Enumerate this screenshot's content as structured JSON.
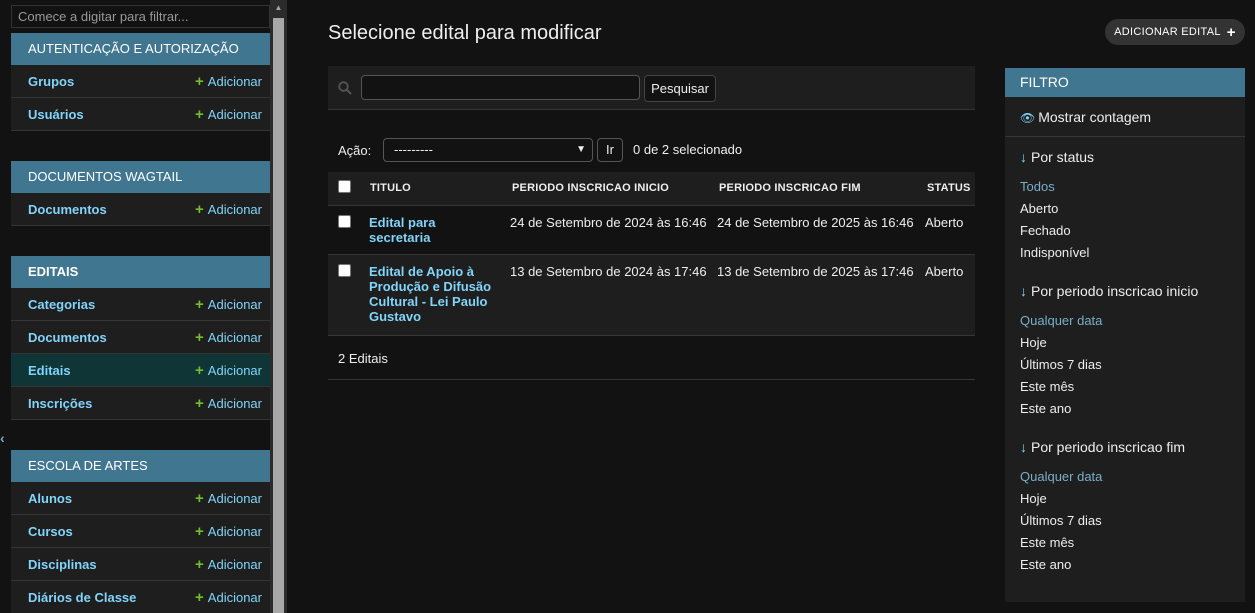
{
  "nav": {
    "filter_placeholder": "Comece a digitar para filtrar...",
    "modules": [
      {
        "caption": "AUTENTICAÇÃO E AUTORIZAÇÃO",
        "items": [
          {
            "label": "Grupos",
            "add": "Adicionar"
          },
          {
            "label": "Usuários",
            "add": "Adicionar"
          }
        ]
      },
      {
        "caption": "DOCUMENTOS WAGTAIL",
        "items": [
          {
            "label": "Documentos",
            "add": "Adicionar"
          }
        ]
      },
      {
        "caption": "EDITAIS",
        "items": [
          {
            "label": "Categorias",
            "add": "Adicionar"
          },
          {
            "label": "Documentos",
            "add": "Adicionar"
          },
          {
            "label": "Editais",
            "add": "Adicionar"
          },
          {
            "label": "Inscrições",
            "add": "Adicionar"
          }
        ]
      },
      {
        "caption": "ESCOLA DE ARTES",
        "items": [
          {
            "label": "Alunos",
            "add": "Adicionar"
          },
          {
            "label": "Cursos",
            "add": "Adicionar"
          },
          {
            "label": "Disciplinas",
            "add": "Adicionar"
          },
          {
            "label": "Diários de Classe",
            "add": "Adicionar"
          }
        ]
      }
    ]
  },
  "main": {
    "title": "Selecione edital para modificar",
    "add_button": "ADICIONAR EDITAL",
    "search_button": "Pesquisar",
    "search_value": "",
    "action_label": "Ação:",
    "action_selected": "---------",
    "go_button": "Ir",
    "selection_counter": "0 de 2 selecionado",
    "columns": [
      "TITULO",
      "PERIODO INSCRICAO INICIO",
      "PERIODO INSCRICAO FIM",
      "STATUS"
    ],
    "rows": [
      {
        "title_lines": [
          "Edital para",
          "secretaria"
        ],
        "inicio": "24 de Setembro de 2024 às 16:46",
        "fim": "24 de Setembro de 2025 às 16:46",
        "status": "Aberto"
      },
      {
        "title_lines": [
          "Edital de Apoio à",
          "Produção e Difusão",
          "Cultural - Lei Paulo",
          "Gustavo"
        ],
        "inicio": "13 de Setembro de 2024 às 17:46",
        "fim": "13 de Setembro de 2025 às 17:46",
        "status": "Aberto"
      }
    ],
    "paginator": "2 Editais"
  },
  "filter": {
    "header": "FILTRO",
    "show_counts": "Mostrar contagem",
    "groups": [
      {
        "title": "Por status",
        "options": [
          "Todos",
          "Aberto",
          "Fechado",
          "Indisponível"
        ],
        "selected": 0
      },
      {
        "title": "Por periodo inscricao inicio",
        "options": [
          "Qualquer data",
          "Hoje",
          "Últimos 7 dias",
          "Este mês",
          "Este ano"
        ],
        "selected": 0
      },
      {
        "title": "Por periodo inscricao fim",
        "options": [
          "Qualquer data",
          "Hoje",
          "Últimos 7 dias",
          "Este mês",
          "Este ano"
        ],
        "selected": 0
      }
    ]
  },
  "colors": {
    "background": "#121212",
    "module_header": "#417690",
    "link": "#81d4fa",
    "add_icon": "#70bf2b",
    "selected_row": "#0f3537"
  }
}
